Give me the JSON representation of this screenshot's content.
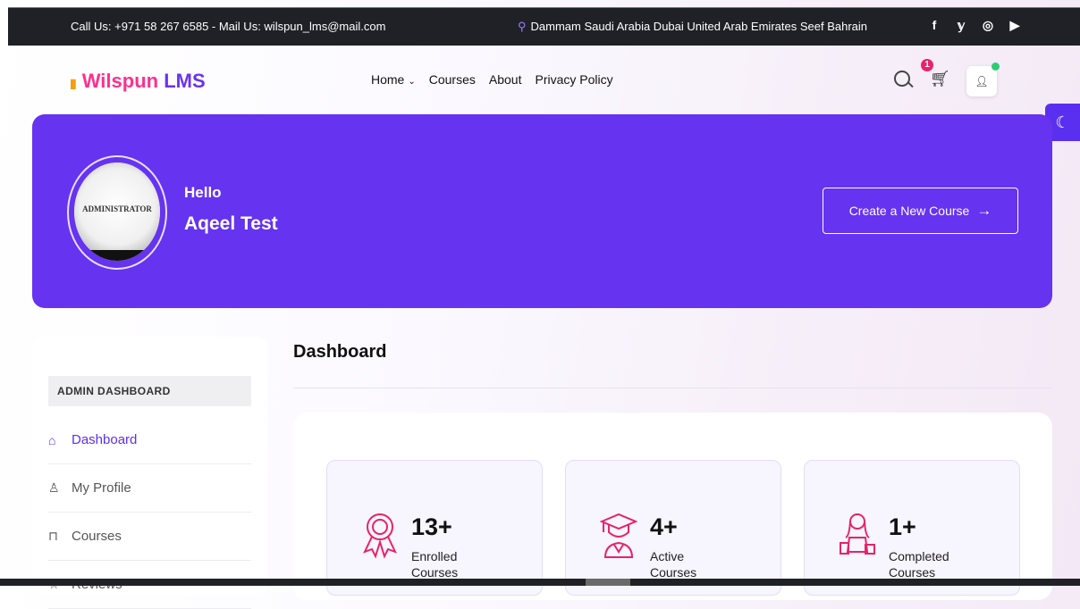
{
  "topbar": {
    "contact": "Call Us: +971 58 267 6585 - Mail Us: wilspun_lms@mail.com",
    "location": "Dammam Saudi Arabia Dubai United Arab Emirates Seef Bahrain",
    "social": [
      "facebook-icon",
      "twitter-icon",
      "instagram-icon",
      "youtube-icon"
    ],
    "social_glyphs": [
      "f",
      "𝕪",
      "◎",
      "▶"
    ]
  },
  "brand": {
    "word1": "Wilspun",
    "word2": "LMS",
    "colors": {
      "word1": "#ff2f8e",
      "word2": "#6a33ee"
    }
  },
  "nav": {
    "items": [
      {
        "label": "Home",
        "has_dropdown": true
      },
      {
        "label": "Courses"
      },
      {
        "label": "About"
      },
      {
        "label": "Privacy Policy"
      }
    ],
    "cart_count": "1"
  },
  "banner": {
    "avatar_text": "ADMINISTRATOR",
    "greeting": "Hello",
    "user_name": "Aqeel Test",
    "create_button": "Create a New Course",
    "background": "#6633f0"
  },
  "sidebar": {
    "heading": "ADMIN DASHBOARD",
    "items": [
      {
        "label": "Dashboard",
        "icon": "home-icon",
        "active": true
      },
      {
        "label": "My Profile",
        "icon": "user-icon"
      },
      {
        "label": "Courses",
        "icon": "bookmark-icon"
      },
      {
        "label": "Reviews",
        "icon": "star-icon"
      }
    ]
  },
  "main": {
    "title": "Dashboard",
    "stats": [
      {
        "value": "13+",
        "label": "Enrolled Courses",
        "icon": "award-ribbon-icon"
      },
      {
        "value": "4+",
        "label": "Active Courses",
        "icon": "graduate-icon"
      },
      {
        "value": "1+",
        "label": "Completed Courses",
        "icon": "girl-with-books-icon"
      }
    ]
  },
  "colors": {
    "accent": "#5b2ff0",
    "icon_pink": "#e8226b"
  }
}
